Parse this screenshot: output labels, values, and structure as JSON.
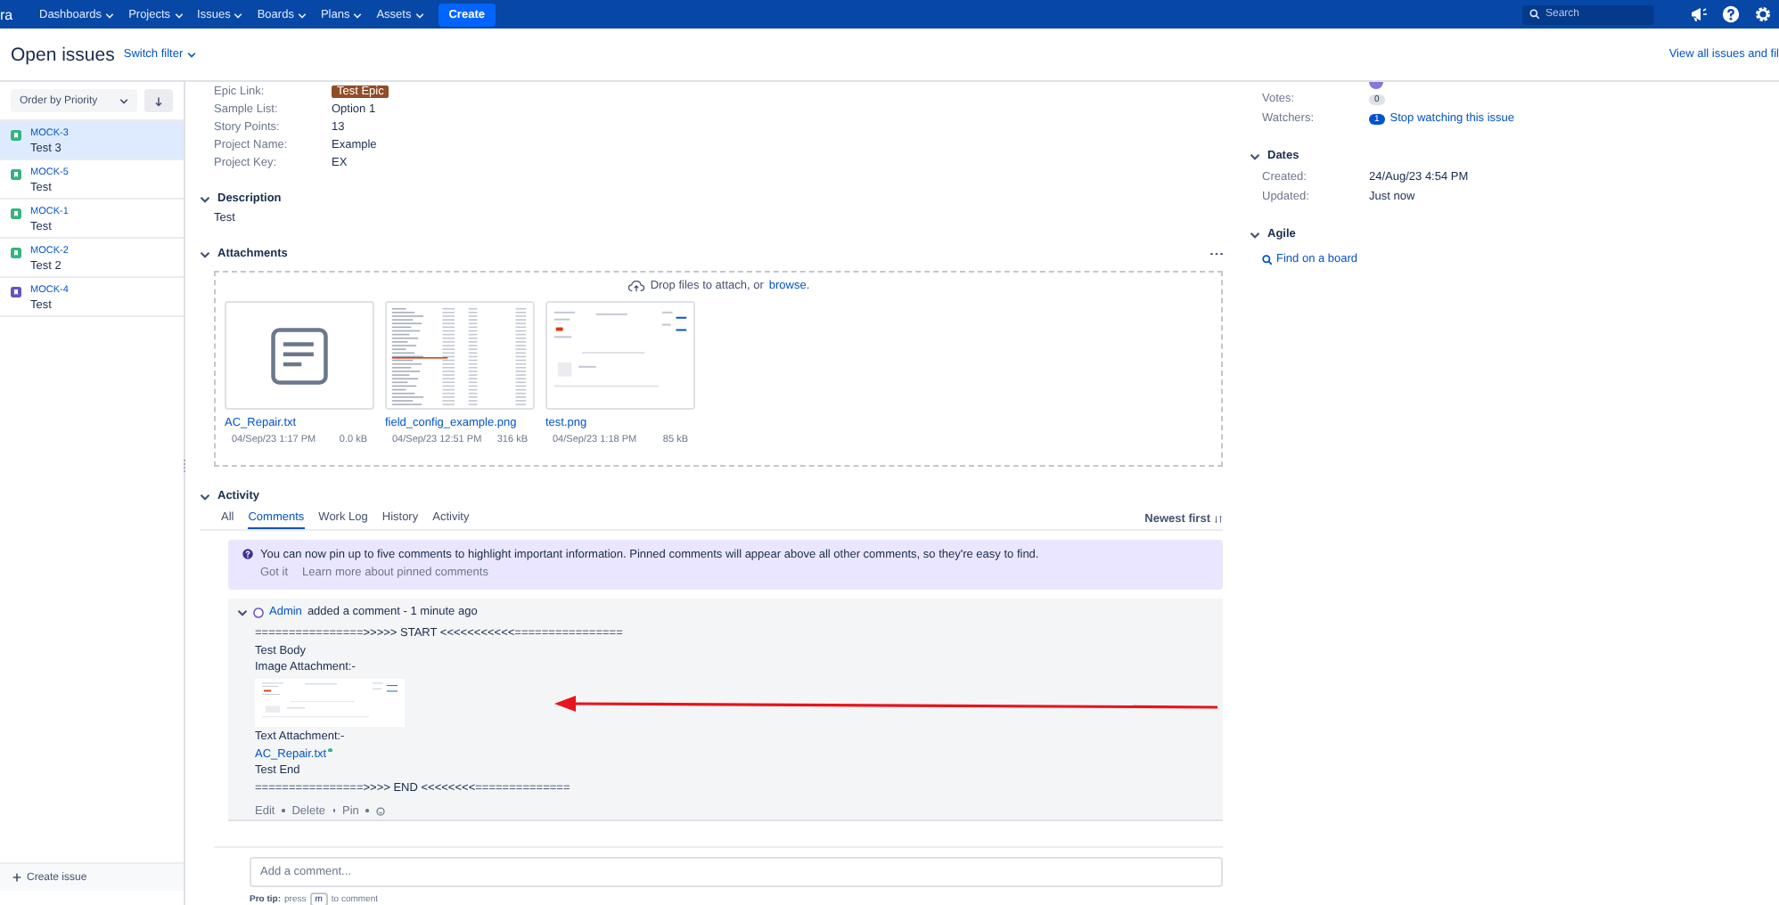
{
  "nav": {
    "logo": "ra",
    "menus": [
      "Dashboards",
      "Projects",
      "Issues",
      "Boards",
      "Plans",
      "Assets"
    ],
    "create": "Create",
    "search_placeholder": "Search"
  },
  "header": {
    "title": "Open issues",
    "switch_filter": "Switch filter",
    "view_all": "View all issues and fil"
  },
  "sidebar": {
    "order": "Order by Priority",
    "issues": [
      {
        "key": "MOCK-3",
        "summary": "Test 3",
        "color": "#36b37e",
        "selected": true
      },
      {
        "key": "MOCK-5",
        "summary": "Test",
        "color": "#36b37e",
        "selected": false
      },
      {
        "key": "MOCK-1",
        "summary": "Test",
        "color": "#36b37e",
        "selected": false
      },
      {
        "key": "MOCK-2",
        "summary": "Test 2",
        "color": "#36b37e",
        "selected": false
      },
      {
        "key": "MOCK-4",
        "summary": "Test",
        "color": "#6554c0",
        "selected": false
      }
    ],
    "create_issue": "Create issue"
  },
  "fields": [
    {
      "label": "Epic Link:",
      "value": "Test Epic",
      "kind": "badge"
    },
    {
      "label": "Sample List:",
      "value": "Option 1",
      "kind": "text"
    },
    {
      "label": "Story Points:",
      "value": "13",
      "kind": "text"
    },
    {
      "label": "Project Name:",
      "value": "Example",
      "kind": "text"
    },
    {
      "label": "Project Key:",
      "value": "EX",
      "kind": "text"
    }
  ],
  "description": {
    "heading": "Description",
    "text": "Test",
    "expanded": true
  },
  "attachments": {
    "heading": "Attachments",
    "expanded": true,
    "drop_text": "Drop files to attach, or",
    "browse": "browse.",
    "files": [
      {
        "name": "AC_Repair.txt",
        "date": "04/Sep/23 1:17 PM",
        "size": "0.0 kB",
        "kind": "file"
      },
      {
        "name": "field_config_example.png",
        "date": "04/Sep/23 12:51 PM",
        "size": "316 kB",
        "kind": "image"
      },
      {
        "name": "test.png",
        "date": "04/Sep/23 1:18 PM",
        "size": "85 kB",
        "kind": "image"
      }
    ]
  },
  "activity": {
    "heading": "Activity",
    "expanded": true,
    "tabs": [
      {
        "label": "All",
        "selected": false
      },
      {
        "label": "Comments",
        "selected": true
      },
      {
        "label": "Work Log",
        "selected": false
      },
      {
        "label": "History",
        "selected": false
      },
      {
        "label": "Activity",
        "selected": false
      }
    ],
    "sort": "Newest first",
    "notice": {
      "text": "You can now pin up to five comments to highlight important information. Pinned comments will appear above all other comments, so they're easy to find.",
      "got_it": "Got it",
      "learn_more": "Learn more about pinned comments"
    },
    "comment": {
      "author": "Admin",
      "meta": "added a comment - 1 minute ago",
      "expanded": true,
      "lines": [
        {
          "kind": "text",
          "text": "================>>>>> START <<<<<<<<<<<================"
        },
        {
          "kind": "text",
          "text": "Test Body"
        },
        {
          "kind": "text",
          "text": "Image Attachment:-"
        },
        {
          "kind": "image"
        },
        {
          "kind": "text",
          "text": "Text Attachment:-"
        },
        {
          "kind": "link",
          "text": "AC_Repair.txt"
        },
        {
          "kind": "text",
          "text": "Test End"
        },
        {
          "kind": "text",
          "text": "================>>>> END <<<<<<<<=============="
        }
      ],
      "actions": [
        "Edit",
        "Delete",
        "Pin"
      ]
    },
    "add_placeholder": "Add a comment...",
    "pro_tip": {
      "label": "Pro tip:",
      "before": "press",
      "key": "m",
      "after": "to comment"
    }
  },
  "people": {
    "votes_label": "Votes:",
    "votes": "0",
    "watchers_label": "Watchers:",
    "watchers": "1",
    "watch_link": "Stop watching this issue"
  },
  "dates": {
    "heading": "Dates",
    "expanded": true,
    "rows": [
      {
        "label": "Created:",
        "value": "24/Aug/23 4:54 PM"
      },
      {
        "label": "Updated:",
        "value": "Just now"
      }
    ]
  },
  "agile": {
    "heading": "Agile",
    "expanded": true,
    "link": "Find on a board"
  }
}
